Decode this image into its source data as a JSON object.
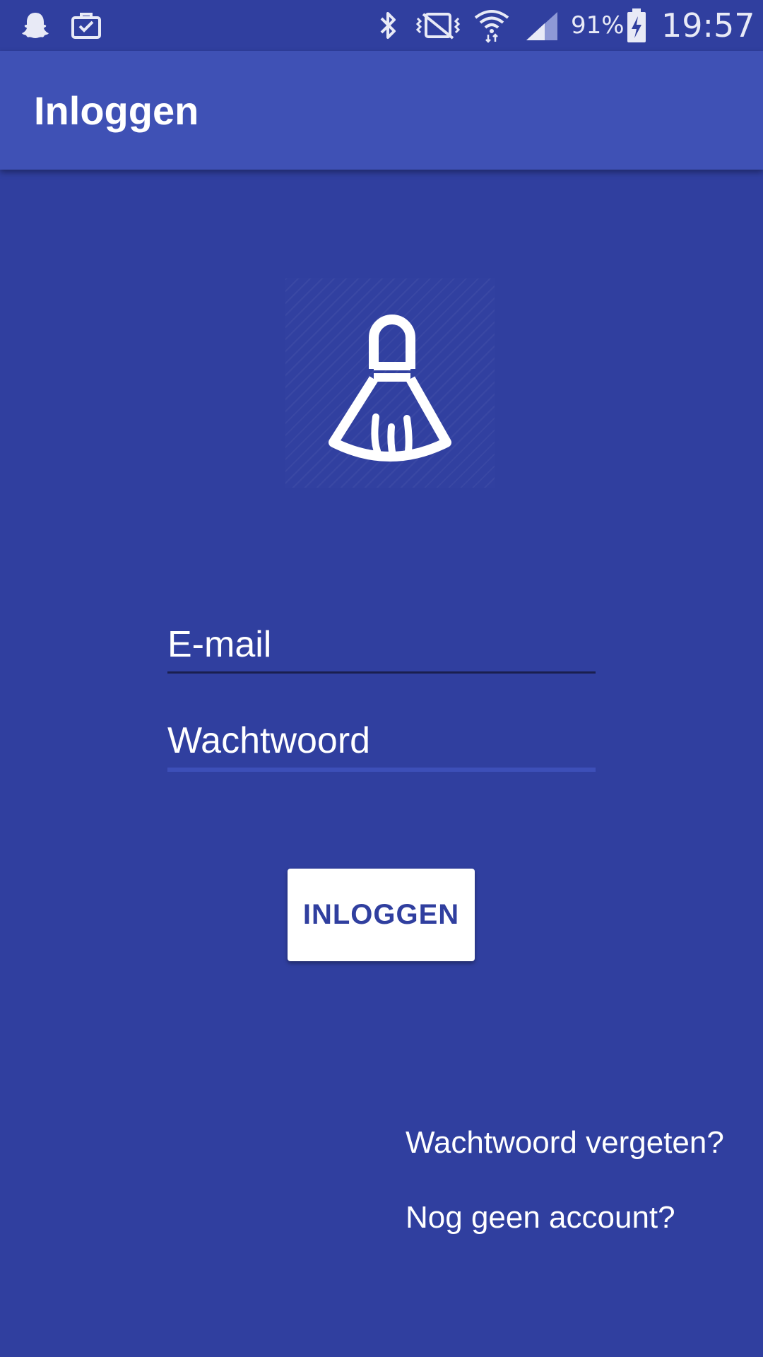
{
  "status_bar": {
    "icons": [
      "snapchat-icon",
      "briefcase-check-icon",
      "bluetooth-icon",
      "vibrate-off-icon",
      "wifi-icon",
      "signal-icon",
      "battery-charging-icon"
    ],
    "battery": "91%",
    "time": "19:57"
  },
  "app_bar": {
    "title": "Inloggen"
  },
  "logo": {
    "icon": "broom-icon"
  },
  "form": {
    "email_placeholder": "E-mail",
    "password_placeholder": "Wachtwoord",
    "login_label": "INLOGGEN"
  },
  "links": {
    "forgot_password": "Wachtwoord vergeten?",
    "register": "Nog geen account?"
  },
  "colors": {
    "background": "#303F9F",
    "app_bar": "#3F51B5",
    "button_background": "#FFFFFF",
    "button_text": "#303F9F"
  }
}
